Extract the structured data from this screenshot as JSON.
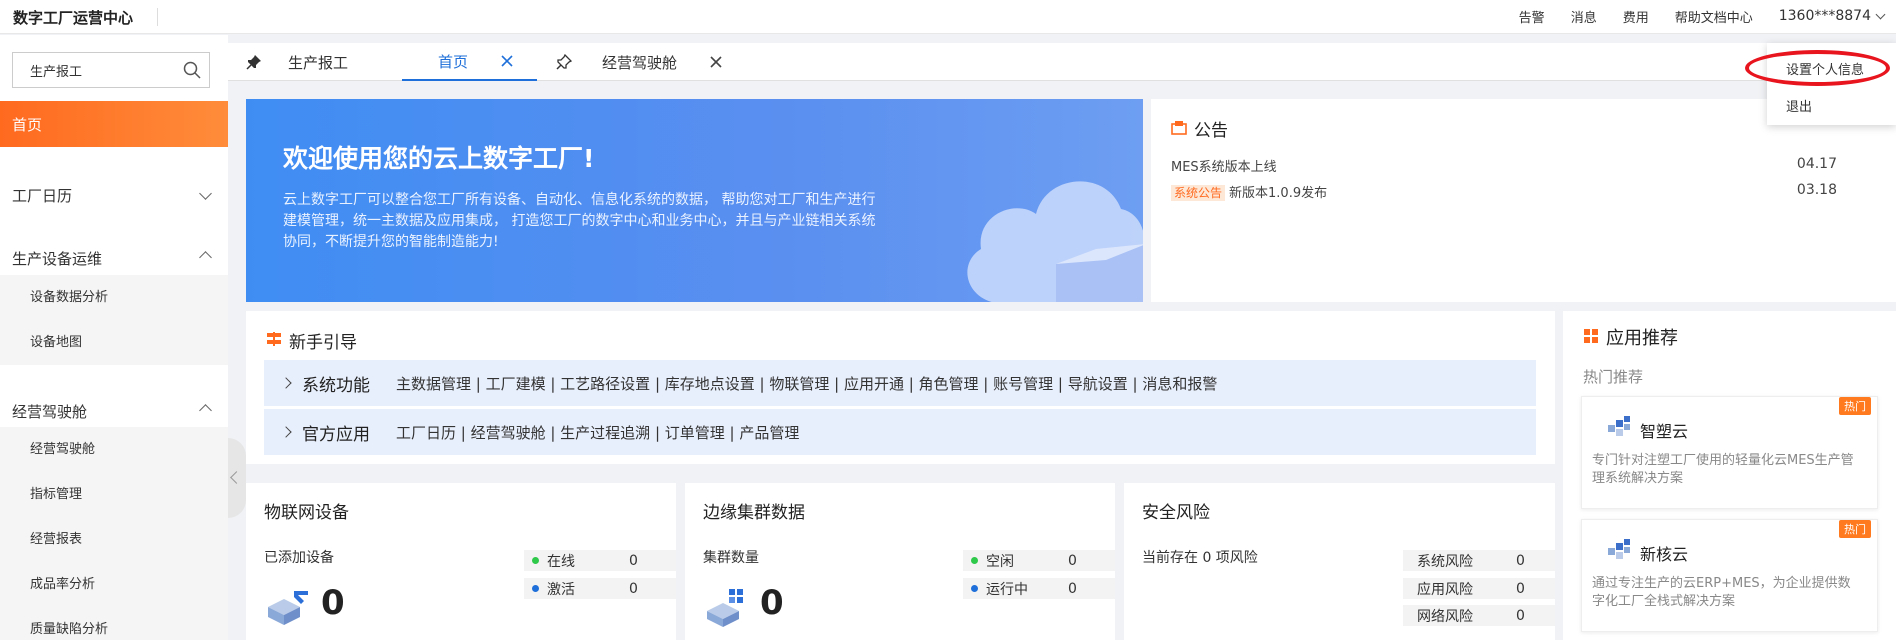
{
  "header": {
    "app_title": "数字工厂运营中心",
    "nav": [
      "告警",
      "消息",
      "费用",
      "帮助文档中心"
    ],
    "user": "1360***8874"
  },
  "user_menu": {
    "items": [
      "设置个人信息",
      "退出"
    ],
    "highlight_color": "#e8141e"
  },
  "sidebar": {
    "search": {
      "value": "生产报工",
      "icon": "search-icon"
    },
    "items": {
      "home": "首页",
      "calendar": "工厂日历",
      "equipment": "生产设备运维",
      "equipment_sub": [
        "设备数据分析",
        "设备地图"
      ],
      "cockpit": "经营驾驶舱",
      "cockpit_sub": [
        "经营驾驶舱",
        "指标管理",
        "经营报表",
        "成品率分析",
        "质量缺陷分析"
      ]
    },
    "accent": "#ff6a1f"
  },
  "tabs": [
    "生产报工",
    "首页",
    "经营驾驶舱"
  ],
  "banner": {
    "title": "欢迎使用您的云上数字工厂!",
    "text": "云上数字工厂可以整合您工厂所有设备、自动化、信息化系统的数据， 帮助您对工厂和生产进行建模管理，统一主数据及应用集成， 打造您工厂的数字中心和业务中心，并且与产业链相关系统协同，不断提升您的智能制造能力!"
  },
  "notice": {
    "title": "公告",
    "rows": [
      {
        "tag": "",
        "text": "MES系统版本上线",
        "date": "04.17"
      },
      {
        "tag": "系统公告",
        "text": "新版本1.0.9发布",
        "date": "03.18"
      }
    ]
  },
  "guide": {
    "title": "新手引导",
    "rows": [
      {
        "head": "系统功能",
        "links": "主数据管理 | 工厂建模 | 工艺路径设置 | 库存地点设置 | 物联管理 | 应用开通 | 角色管理 | 账号管理 | 导航设置 | 消息和报警"
      },
      {
        "head": "官方应用",
        "links": "工厂日历 | 经营驾驶舱 | 生产过程追溯 | 订单管理 | 产品管理"
      }
    ]
  },
  "apps": {
    "title": "应用推荐",
    "subtitle": "热门推荐",
    "cards": [
      {
        "name": "智塑云",
        "badge": "热门",
        "desc": "专门针对注塑工厂使用的轻量化云MES生产管理系统解决方案"
      },
      {
        "name": "新核云",
        "badge": "热门",
        "desc": "通过专注生产的云ERP+MES，为企业提供数字化工厂全栈式解决方案"
      }
    ]
  },
  "stats": {
    "iot": {
      "title": "物联网设备",
      "sub": "已添加设备",
      "count": "0",
      "kv": [
        {
          "k": "在线",
          "v": "0",
          "color": "#2ec84a"
        },
        {
          "k": "激活",
          "v": "0",
          "color": "#1e6fd9"
        }
      ]
    },
    "edge": {
      "title": "边缘集群数据",
      "sub": "集群数量",
      "count": "0",
      "kv": [
        {
          "k": "空闲",
          "v": "0",
          "color": "#2ec84a"
        },
        {
          "k": "运行中",
          "v": "0",
          "color": "#1e6fd9"
        }
      ]
    },
    "risk": {
      "title": "安全风险",
      "sub": "当前存在 0 项风险",
      "kv": [
        {
          "k": "系统风险",
          "v": "0"
        },
        {
          "k": "应用风险",
          "v": "0"
        },
        {
          "k": "网络风险",
          "v": "0"
        }
      ]
    }
  }
}
